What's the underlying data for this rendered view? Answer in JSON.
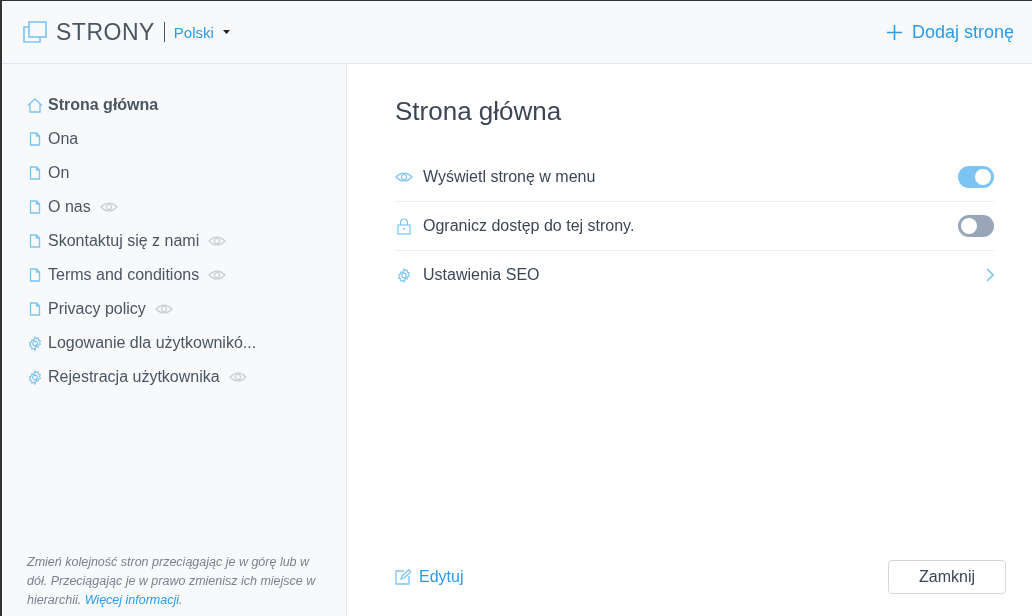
{
  "header": {
    "title": "STRONY",
    "language": "Polski",
    "add_button": "Dodaj stronę"
  },
  "sidebar": {
    "items": [
      {
        "label": "Strona główna",
        "kind": "home",
        "selected": true,
        "hidden": false
      },
      {
        "label": "Ona",
        "kind": "page",
        "selected": false,
        "hidden": false
      },
      {
        "label": "On",
        "kind": "page",
        "selected": false,
        "hidden": false
      },
      {
        "label": "O nas",
        "kind": "page",
        "selected": false,
        "hidden": true
      },
      {
        "label": "Skontaktuj się z nami",
        "kind": "page",
        "selected": false,
        "hidden": true
      },
      {
        "label": "Terms and conditions",
        "kind": "page",
        "selected": false,
        "hidden": true
      },
      {
        "label": "Privacy policy",
        "kind": "page",
        "selected": false,
        "hidden": true
      },
      {
        "label": "Logowanie dla użytkownikó...",
        "kind": "settings",
        "selected": false,
        "hidden": false
      },
      {
        "label": "Rejestracja użytkownika",
        "kind": "settings",
        "selected": false,
        "hidden": true
      }
    ],
    "hint": "Zmień kolejność stron przeciągając je w górę lub w dół. Przeciągając je w prawo zmienisz ich miejsce w hierarchii.",
    "hint_link": "Więcej informacji",
    "hint_end": "."
  },
  "panel": {
    "title": "Strona główna",
    "rows": [
      {
        "label": "Wyświetl stronę w menu",
        "kind": "toggle",
        "on": true
      },
      {
        "label": "Ogranicz dostęp do tej strony.",
        "kind": "toggle",
        "on": false
      },
      {
        "label": "Ustawienia SEO",
        "kind": "link"
      }
    ],
    "edit_button": "Edytuj",
    "close_button": "Zamknij"
  }
}
